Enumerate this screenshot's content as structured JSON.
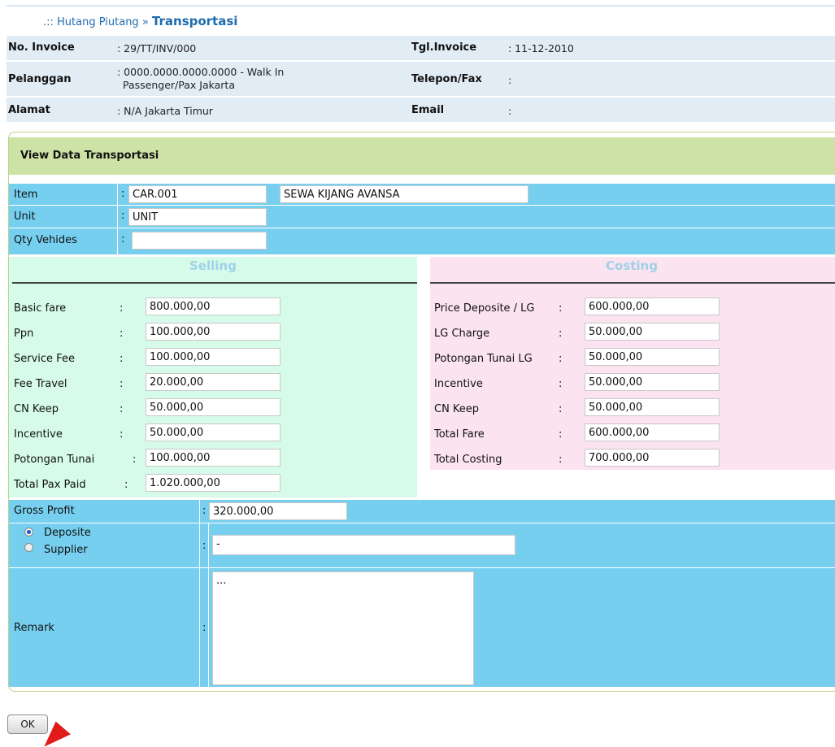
{
  "breadcrumb": {
    "prefix": ".:: Hutang Piutang",
    "sep": " » ",
    "current": "Transportasi"
  },
  "invoice": {
    "no_label": "No. Invoice",
    "no_value": ": 29/TT/INV/000",
    "tgl_label": "Tgl.Invoice",
    "tgl_value": ": 11-12-2010",
    "pelanggan_label": "Pelanggan",
    "pelanggan_value_1": ": 0000.0000.0000.0000 - Walk In",
    "pelanggan_value_2": "Passenger/Pax Jakarta",
    "telepon_label": "Telepon/Fax",
    "telepon_value": ":",
    "alamat_label": "Alamat",
    "alamat_value": ": N/A Jakarta Timur",
    "email_label": "Email",
    "email_value": ":"
  },
  "panel": {
    "title": "View Data Transportasi",
    "item_label": "Item",
    "item_code": "CAR.001",
    "item_name": "SEWA KIJANG AVANSA",
    "unit_label": "Unit",
    "unit_value": "UNIT",
    "qty_label": "Qty Vehides",
    "qty_value": "",
    "colon": ":"
  },
  "selling": {
    "title": "Selling",
    "fields": [
      {
        "label": "Basic fare",
        "value": "800.000,00"
      },
      {
        "label": "Ppn",
        "value": "100.000,00"
      },
      {
        "label": "Service Fee",
        "value": "100.000,00"
      },
      {
        "label": "Fee Travel",
        "value": "20.000,00"
      },
      {
        "label": "CN Keep",
        "value": "50.000,00"
      },
      {
        "label": "Incentive",
        "value": "50.000,00"
      },
      {
        "label": "Potongan Tunai",
        "value": "100.000,00"
      },
      {
        "label": "Total Pax Paid",
        "value": "1.020.000,00"
      }
    ]
  },
  "costing": {
    "title": "Costing",
    "fields": [
      {
        "label": "Price Deposite / LG",
        "value": "600.000,00"
      },
      {
        "label": "LG Charge",
        "value": "50.000,00"
      },
      {
        "label": "Potongan Tunai LG",
        "value": "50.000,00"
      },
      {
        "label": "Incentive",
        "value": "50.000,00"
      },
      {
        "label": "CN Keep",
        "value": "50.000,00"
      },
      {
        "label": "Total Fare",
        "value": "600.000,00"
      },
      {
        "label": "Total Costing",
        "value": "700.000,00"
      }
    ]
  },
  "gross_profit": {
    "label": "Gross Profit",
    "value": "320.000,00"
  },
  "payment": {
    "option_deposite": "Deposite",
    "option_supplier": "Supplier",
    "selected": "Deposite",
    "value": "-"
  },
  "remark": {
    "label": "Remark",
    "value": "..."
  },
  "ok_button": "OK",
  "colors": {
    "header_bg": "#e1ecf5",
    "panel_title_bg": "#cde3a6",
    "row_blue": "#76cfef",
    "selling_bg": "#d6fbeb",
    "costing_bg": "#fbe3f0",
    "link": "#1f6cb0"
  }
}
